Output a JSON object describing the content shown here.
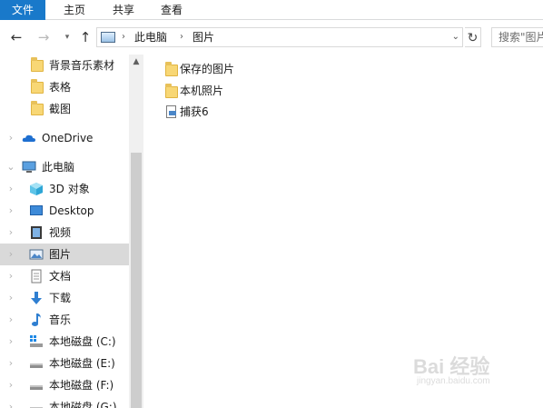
{
  "ribbon": {
    "tabs": [
      "文件",
      "主页",
      "共享",
      "查看"
    ]
  },
  "nav": {
    "back_icon": "back-arrow-icon",
    "forward_icon": "forward-arrow-icon",
    "recent_icon": "chevron-down-icon",
    "up_icon": "up-arrow-icon"
  },
  "address": {
    "crumbs": [
      "此电脑",
      "图片"
    ],
    "separator": "›"
  },
  "search": {
    "placeholder": "搜索\"图片\""
  },
  "sidebar": {
    "items": [
      {
        "label": "背景音乐素材",
        "icon": "folder-icon"
      },
      {
        "label": "表格",
        "icon": "folder-icon"
      },
      {
        "label": "截图",
        "icon": "folder-icon"
      },
      {
        "label": "OneDrive",
        "icon": "cloud-icon"
      },
      {
        "label": "此电脑",
        "icon": "computer-icon"
      },
      {
        "label": "3D 对象",
        "icon": "cube-3d-icon"
      },
      {
        "label": "Desktop",
        "icon": "desktop-icon"
      },
      {
        "label": "视频",
        "icon": "video-icon"
      },
      {
        "label": "图片",
        "icon": "pictures-icon",
        "selected": true
      },
      {
        "label": "文档",
        "icon": "documents-icon"
      },
      {
        "label": "下载",
        "icon": "download-icon"
      },
      {
        "label": "音乐",
        "icon": "music-icon"
      },
      {
        "label": "本地磁盘 (C:)",
        "icon": "windows-drive-icon"
      },
      {
        "label": "本地磁盘 (E:)",
        "icon": "drive-icon"
      },
      {
        "label": "本地磁盘 (F:)",
        "icon": "drive-icon"
      },
      {
        "label": "本地磁盘 (G:)",
        "icon": "drive-icon"
      }
    ]
  },
  "content": {
    "items": [
      {
        "label": "保存的图片",
        "type": "folder"
      },
      {
        "label": "本机照片",
        "type": "folder"
      },
      {
        "label": "捕获6",
        "type": "image-file"
      }
    ]
  },
  "watermark": {
    "main": "Bai 经验",
    "sub": "jingyan.baidu.com"
  },
  "colors": {
    "file_tab": "#1979ca",
    "selected_row": "#d9d9d9",
    "folder": "#f8d775"
  }
}
